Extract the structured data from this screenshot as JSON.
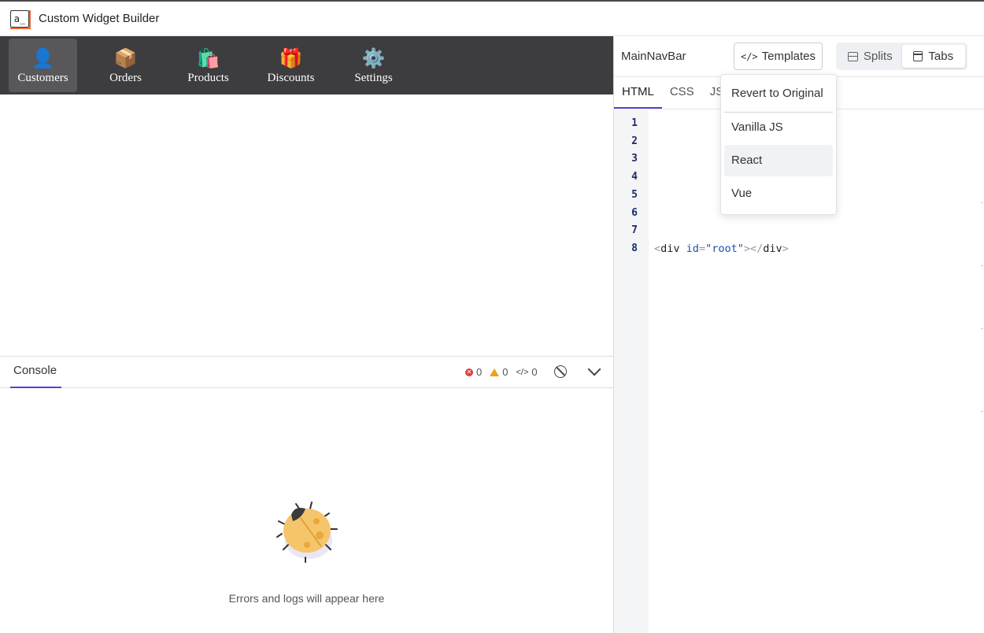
{
  "app": {
    "logo_text": "a_",
    "title": "Custom Widget Builder"
  },
  "preview_nav": {
    "items": [
      {
        "emoji": "👤",
        "label": "Customers",
        "active": true
      },
      {
        "emoji": "📦",
        "label": "Orders"
      },
      {
        "emoji": "🛍️",
        "label": "Products"
      },
      {
        "emoji": "🎁",
        "label": "Discounts"
      },
      {
        "emoji": "⚙️",
        "label": "Settings"
      }
    ]
  },
  "console": {
    "tab_label": "Console",
    "errors": "0",
    "warnings": "0",
    "logs": "0",
    "empty_message": "Errors and logs will appear here"
  },
  "editor_header": {
    "widget_name": "MainNavBar",
    "templates_label": "Templates",
    "splits_label": "Splits",
    "tabs_label": "Tabs",
    "active_view": "Tabs"
  },
  "code_tabs": [
    "HTML",
    "CSS",
    "JS"
  ],
  "editor": {
    "line_numbers": [
      "1",
      "2",
      "3",
      "4",
      "5",
      "6",
      "7",
      "8"
    ],
    "code": {
      "open": "<",
      "tag": "div",
      "attr": "id",
      "eq": "=",
      "value": "\"root\"",
      "close_open": "></",
      "close_tag": "div",
      "end": ">"
    }
  },
  "templates_menu": {
    "items": [
      "Revert to Original",
      "Vanilla JS",
      "React",
      "Vue"
    ],
    "hovered": "React"
  },
  "colors": {
    "accent": "#5b3ed6",
    "nav_bg": "#3d3c3e",
    "logo_accent": "#f06a2f"
  }
}
